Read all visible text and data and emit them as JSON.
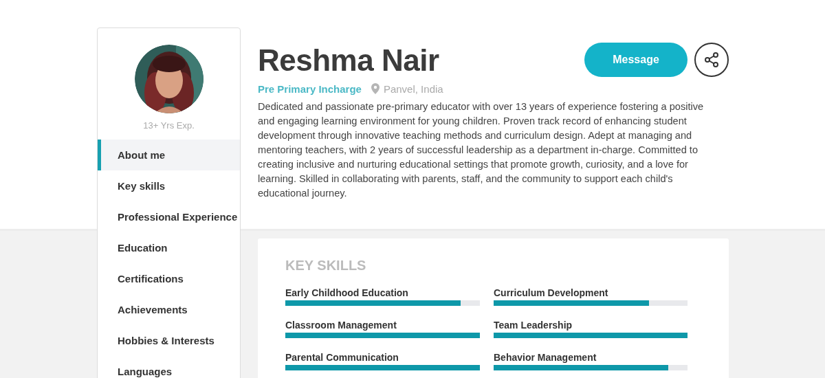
{
  "profile": {
    "experience": "13+ Yrs Exp.",
    "name": "Reshma Nair",
    "role": "Pre Primary Incharge",
    "location": "Panvel, India",
    "bio": "Dedicated and passionate pre-primary educator with over 13 years of experience fostering a positive and engaging learning environment for young children. Proven track record of enhancing student development through innovative teaching methods and curriculum design. Adept at managing and mentoring teachers, with 2 years of successful leadership as a department in-charge. Committed to creating inclusive and nurturing educational settings that promote growth, curiosity, and a love for learning. Skilled in collaborating with parents, staff, and the community to support each child's educational journey."
  },
  "actions": {
    "message": "Message"
  },
  "sidebar": {
    "items": [
      {
        "label": "About me",
        "selected": true
      },
      {
        "label": "Key skills",
        "selected": false
      },
      {
        "label": "Professional Experience",
        "selected": false
      },
      {
        "label": "Education",
        "selected": false
      },
      {
        "label": "Certifications",
        "selected": false
      },
      {
        "label": "Achievements",
        "selected": false
      },
      {
        "label": "Hobbies & Interests",
        "selected": false
      },
      {
        "label": "Languages",
        "selected": false
      }
    ]
  },
  "skills": {
    "title": "KEY SKILLS",
    "items": [
      {
        "name": "Early Childhood Education",
        "level": 0.9
      },
      {
        "name": "Curriculum Development",
        "level": 0.8
      },
      {
        "name": "Classroom Management",
        "level": 1
      },
      {
        "name": "Team Leadership",
        "level": 1
      },
      {
        "name": "Parental Communication",
        "level": 1
      },
      {
        "name": "Behavior Management",
        "level": 0.9
      }
    ]
  }
}
